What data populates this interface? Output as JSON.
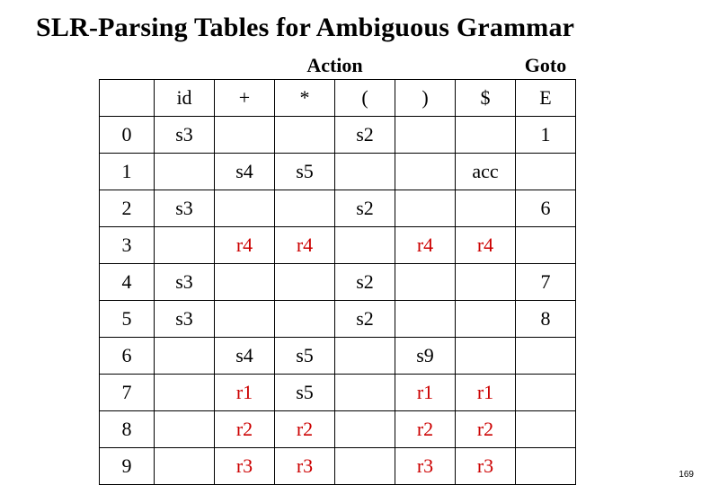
{
  "title": "SLR-Parsing Tables for Ambiguous Grammar",
  "group_headers": {
    "action": "Action",
    "goto": "Goto"
  },
  "columns": {
    "state": "",
    "action": [
      "id",
      "+",
      "*",
      "(",
      ")",
      "$"
    ],
    "goto": [
      "E"
    ]
  },
  "rows": [
    {
      "state": "0",
      "cells": [
        "s3",
        "",
        "",
        "s2",
        "",
        "",
        "1"
      ]
    },
    {
      "state": "1",
      "cells": [
        "",
        "s4",
        "s5",
        "",
        "",
        "acc",
        ""
      ]
    },
    {
      "state": "2",
      "cells": [
        "s3",
        "",
        "",
        "s2",
        "",
        "",
        "6"
      ]
    },
    {
      "state": "3",
      "cells": [
        "",
        "r4",
        "r4",
        "",
        "r4",
        "r4",
        ""
      ]
    },
    {
      "state": "4",
      "cells": [
        "s3",
        "",
        "",
        "s2",
        "",
        "",
        "7"
      ]
    },
    {
      "state": "5",
      "cells": [
        "s3",
        "",
        "",
        "s2",
        "",
        "",
        "8"
      ]
    },
    {
      "state": "6",
      "cells": [
        "",
        "s4",
        "s5",
        "",
        "s9",
        "",
        ""
      ]
    },
    {
      "state": "7",
      "cells": [
        "",
        "r1",
        "s5",
        "",
        "r1",
        "r1",
        ""
      ]
    },
    {
      "state": "8",
      "cells": [
        "",
        "r2",
        "r2",
        "",
        "r2",
        "r2",
        ""
      ]
    },
    {
      "state": "9",
      "cells": [
        "",
        "r3",
        "r3",
        "",
        "r3",
        "r3",
        ""
      ]
    }
  ],
  "page_number": "169",
  "colors": {
    "reduce": "#cc0000"
  }
}
